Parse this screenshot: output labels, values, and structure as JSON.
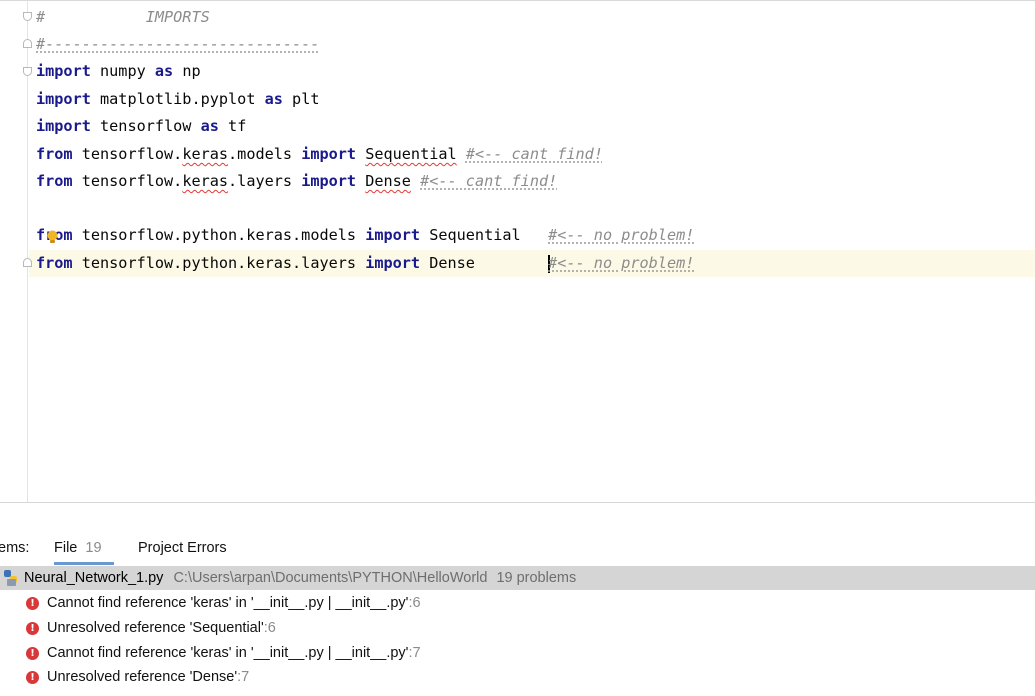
{
  "editor": {
    "lines": [
      {
        "id": "l1",
        "segments": [
          {
            "t": "#           IMPORTS",
            "c": "cmt-plain"
          }
        ]
      },
      {
        "id": "l2",
        "segments": [
          {
            "t": "#------------------------------",
            "c": "cmt"
          }
        ]
      },
      {
        "id": "l3",
        "segments": [
          {
            "t": "import",
            "c": "kw"
          },
          {
            "t": " numpy ",
            "c": ""
          },
          {
            "t": "as",
            "c": "kw"
          },
          {
            "t": " np",
            "c": ""
          }
        ]
      },
      {
        "id": "l4",
        "segments": [
          {
            "t": "import",
            "c": "kw"
          },
          {
            "t": " matplotlib.pyplot ",
            "c": ""
          },
          {
            "t": "as",
            "c": "kw"
          },
          {
            "t": " plt",
            "c": ""
          }
        ]
      },
      {
        "id": "l5",
        "segments": [
          {
            "t": "import",
            "c": "kw"
          },
          {
            "t": " tensorflow ",
            "c": ""
          },
          {
            "t": "as",
            "c": "kw"
          },
          {
            "t": " tf",
            "c": ""
          }
        ]
      },
      {
        "id": "l6",
        "segments": [
          {
            "t": "from",
            "c": "kw"
          },
          {
            "t": " tensorflow.",
            "c": ""
          },
          {
            "t": "keras",
            "c": "err"
          },
          {
            "t": ".models ",
            "c": ""
          },
          {
            "t": "import",
            "c": "kw"
          },
          {
            "t": " ",
            "c": ""
          },
          {
            "t": "Sequential",
            "c": "err"
          },
          {
            "t": " ",
            "c": ""
          },
          {
            "t": "#<-- cant find!",
            "c": "cmt"
          }
        ]
      },
      {
        "id": "l7",
        "segments": [
          {
            "t": "from",
            "c": "kw"
          },
          {
            "t": " tensorflow.",
            "c": ""
          },
          {
            "t": "keras",
            "c": "err"
          },
          {
            "t": ".layers ",
            "c": ""
          },
          {
            "t": "import",
            "c": "kw"
          },
          {
            "t": " ",
            "c": ""
          },
          {
            "t": "Dense",
            "c": "err"
          },
          {
            "t": " ",
            "c": ""
          },
          {
            "t": "#<-- cant find!",
            "c": "cmt"
          }
        ]
      },
      {
        "id": "l8",
        "segments": []
      },
      {
        "id": "l9",
        "segments": [
          {
            "t": "from",
            "c": "kw"
          },
          {
            "t": " tensorflow.python.keras.models ",
            "c": ""
          },
          {
            "t": "import",
            "c": "kw"
          },
          {
            "t": " Sequential   ",
            "c": ""
          },
          {
            "t": "#<-- no problem!",
            "c": "cmt"
          }
        ]
      },
      {
        "id": "l10",
        "segments": [
          {
            "t": "from",
            "c": "kw"
          },
          {
            "t": " tensorflow.python.keras.layers ",
            "c": ""
          },
          {
            "t": "import",
            "c": "kw"
          },
          {
            "t": " Dense        ",
            "c": ""
          },
          {
            "t": "#<-- no problem!",
            "c": "cmt",
            "caret": true
          }
        ]
      }
    ]
  },
  "problems": {
    "panel_label": "ems:",
    "tabs": [
      {
        "label": "File",
        "count": "19"
      },
      {
        "label": "Project Errors",
        "count": ""
      }
    ],
    "file": {
      "name": "Neural_Network_1.py",
      "path": "C:\\Users\\arpan\\Documents\\PYTHON\\HelloWorld",
      "problems": "19 problems"
    },
    "items": [
      {
        "text": "Cannot find reference 'keras' in '__init__.py | __init__.py'",
        "line": ":6"
      },
      {
        "text": "Unresolved reference 'Sequential'",
        "line": ":6"
      },
      {
        "text": "Cannot find reference 'keras' in '__init__.py | __init__.py'",
        "line": ":7"
      },
      {
        "text": "Unresolved reference 'Dense'",
        "line": ":7"
      }
    ]
  },
  "colors": {
    "error_red": "#d9383a",
    "current_line": "#fcfae6",
    "file_row_bg": "#d5d5d5",
    "tab_underline": "#6a98d0"
  },
  "icons": [
    "fold-marker-icon",
    "intention-bulb-icon",
    "python-file-icon",
    "error-icon"
  ]
}
